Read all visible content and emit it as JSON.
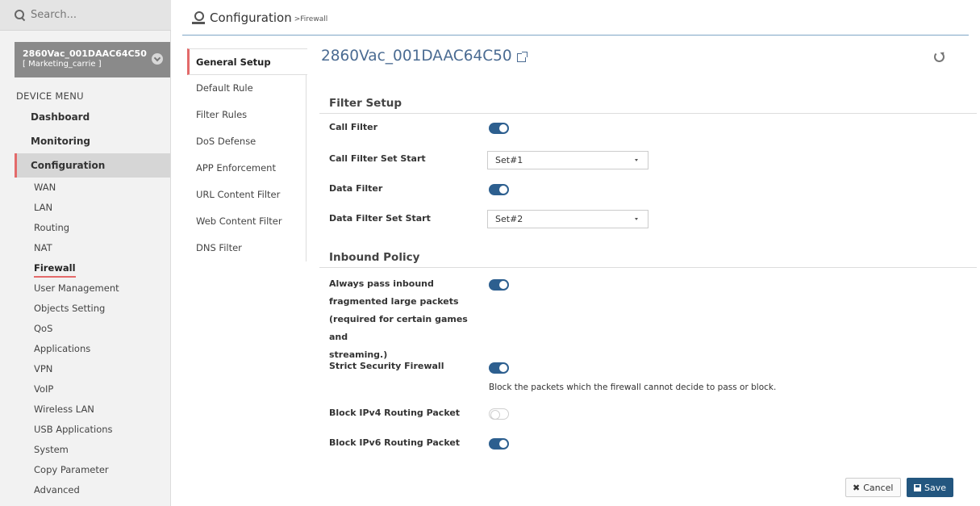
{
  "search": {
    "placeholder": "Search..."
  },
  "device": {
    "name": "2860Vac_001DAAC64C50",
    "user": "[ Marketing_carrie ]"
  },
  "sidebar": {
    "menu_title": "DEVICE MENU",
    "main_items": [
      {
        "label": "Dashboard"
      },
      {
        "label": "Monitoring"
      },
      {
        "label": "Configuration"
      }
    ],
    "sub_items": [
      {
        "label": "WAN"
      },
      {
        "label": "LAN"
      },
      {
        "label": "Routing"
      },
      {
        "label": "NAT"
      },
      {
        "label": "Firewall"
      },
      {
        "label": "User Management"
      },
      {
        "label": "Objects Setting"
      },
      {
        "label": "QoS"
      },
      {
        "label": "Applications"
      },
      {
        "label": "VPN"
      },
      {
        "label": "VoIP"
      },
      {
        "label": "Wireless LAN"
      },
      {
        "label": "USB Applications"
      },
      {
        "label": "System"
      },
      {
        "label": "Copy Parameter"
      },
      {
        "label": "Advanced"
      }
    ]
  },
  "header": {
    "title": "Configuration",
    "breadcrumb": ">Firewall"
  },
  "subnav": {
    "tabs": [
      {
        "label": "General Setup"
      },
      {
        "label": "Default Rule"
      },
      {
        "label": "Filter Rules"
      },
      {
        "label": "DoS Defense"
      },
      {
        "label": "APP Enforcement"
      },
      {
        "label": "URL Content Filter"
      },
      {
        "label": "Web Content Filter"
      },
      {
        "label": "DNS Filter"
      }
    ]
  },
  "main": {
    "device_title": "2860Vac_001DAAC64C50",
    "filter_setup": {
      "title": "Filter Setup",
      "call_filter_label": "Call Filter",
      "call_filter_enabled": true,
      "call_filter_set_label": "Call Filter Set Start",
      "call_filter_set_value": "Set#1",
      "data_filter_label": "Data Filter",
      "data_filter_enabled": true,
      "data_filter_set_label": "Data Filter Set Start",
      "data_filter_set_value": "Set#2"
    },
    "inbound_policy": {
      "title": "Inbound Policy",
      "frag_label_1": "Always pass inbound",
      "frag_label_2": "fragmented large packets",
      "frag_label_3": "(required for certain games and",
      "frag_label_4": "streaming.)",
      "frag_enabled": true,
      "strict_label": "Strict Security Firewall",
      "strict_enabled": true,
      "strict_hint": "Block the packets which the firewall cannot decide to pass or block.",
      "ipv4_label": "Block IPv4 Routing Packet",
      "ipv4_enabled": false,
      "ipv6_label": "Block IPv6 Routing Packet",
      "ipv6_enabled": true
    }
  },
  "buttons": {
    "cancel": "Cancel",
    "save": "Save"
  },
  "colors": {
    "accent": "#2d5f8f",
    "active_marker": "#e36a6a",
    "save_bg": "#23567f"
  }
}
